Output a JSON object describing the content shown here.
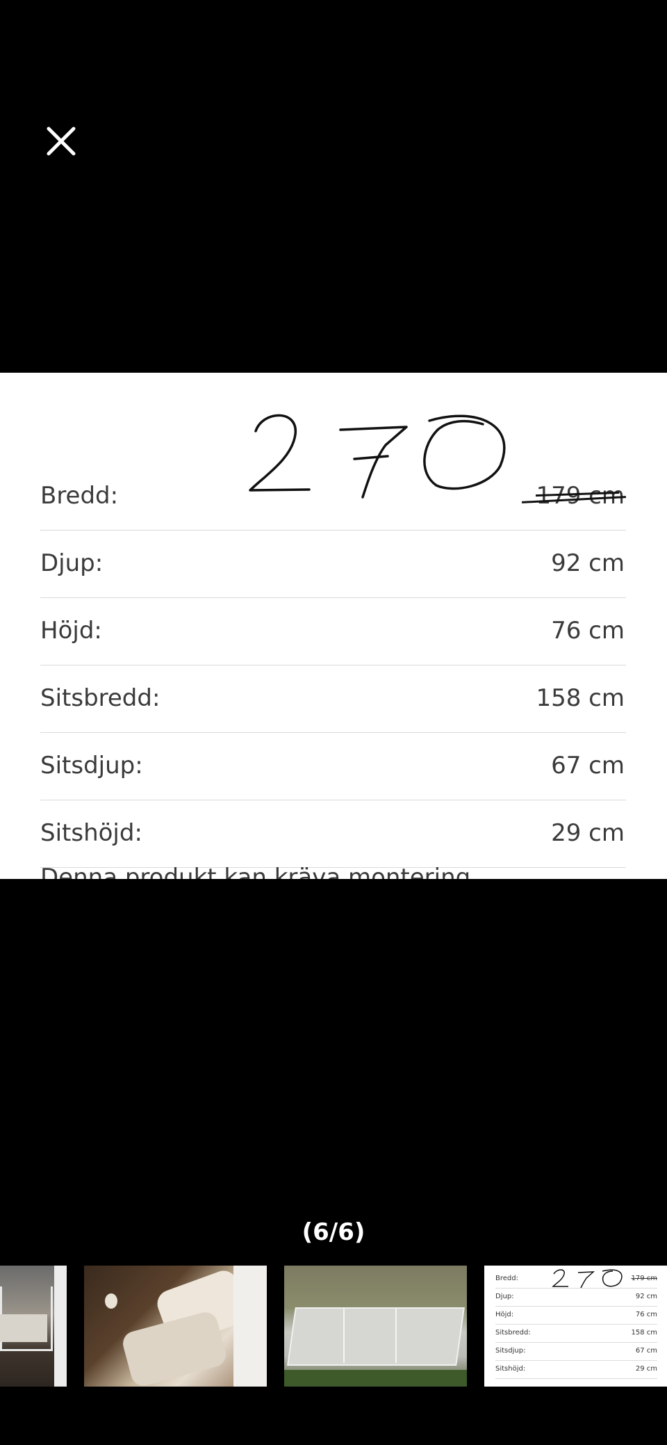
{
  "viewer": {
    "close_icon": "close-icon",
    "counter": "(6/6)"
  },
  "specs": {
    "rows": [
      {
        "label": "Bredd:",
        "value": "179 cm",
        "struck": true
      },
      {
        "label": "Djup:",
        "value": "92 cm"
      },
      {
        "label": "Höjd:",
        "value": "76 cm"
      },
      {
        "label": "Sitsbredd:",
        "value": "158 cm"
      },
      {
        "label": "Sitsdjup:",
        "value": "67 cm"
      },
      {
        "label": "Sitshöjd:",
        "value": "29 cm"
      }
    ],
    "handwritten_value": "270",
    "note": "Denna produkt kan kräva montering"
  },
  "thumbnails": {
    "count": 4,
    "selected_index": 3,
    "mini_rows": [
      {
        "label": "Bredd:",
        "value": "179 cm"
      },
      {
        "label": "Djup:",
        "value": "92 cm"
      },
      {
        "label": "Höjd:",
        "value": "76 cm"
      },
      {
        "label": "Sitsbredd:",
        "value": "158 cm"
      },
      {
        "label": "Sitsdjup:",
        "value": "67 cm"
      },
      {
        "label": "Sitshöjd:",
        "value": "29 cm"
      }
    ],
    "mini_handwritten": "270"
  },
  "colors": {
    "background": "#000000",
    "photo_bg": "#ffffff",
    "text": "#3a3a3a"
  }
}
